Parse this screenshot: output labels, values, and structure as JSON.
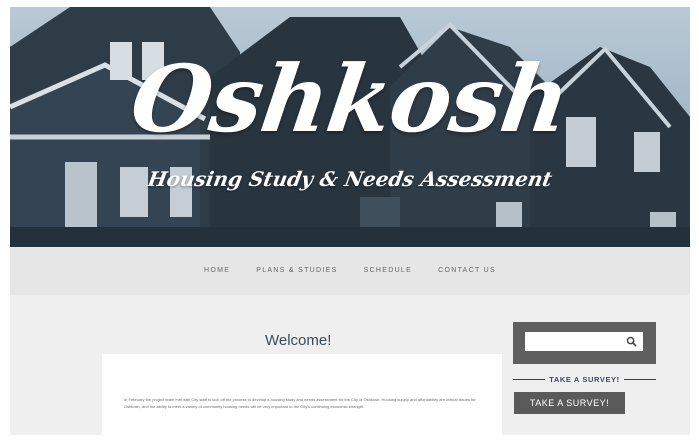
{
  "hero": {
    "title": "Oshkosh",
    "subtitle": "Housing Study & Needs Assessment"
  },
  "nav": {
    "items": [
      {
        "label": "HOME"
      },
      {
        "label": "PLANS & STUDIES"
      },
      {
        "label": "SCHEDULE"
      },
      {
        "label": "CONTACT US"
      }
    ]
  },
  "main": {
    "heading": "Welcome!",
    "body": "In February the project team met with City staff to kick off the process to develop a housing study and needs assessment for the City of Oshkosh. Housing supply and affordability are critical issues for Oshkosh, and the ability to meet a variety of community housing needs will be very important to the City's continuing economic strength."
  },
  "sidebar": {
    "search_placeholder": "",
    "survey_heading": "TAKE A SURVEY!",
    "survey_button": "TAKE A SURVEY!"
  },
  "colors": {
    "nav_bg": "#e6e6e6",
    "content_bg": "#efefef",
    "sidebar_dark": "#5f5f5f",
    "heading_blue": "#3b4a5c"
  },
  "icons": {
    "search": "search-icon"
  }
}
